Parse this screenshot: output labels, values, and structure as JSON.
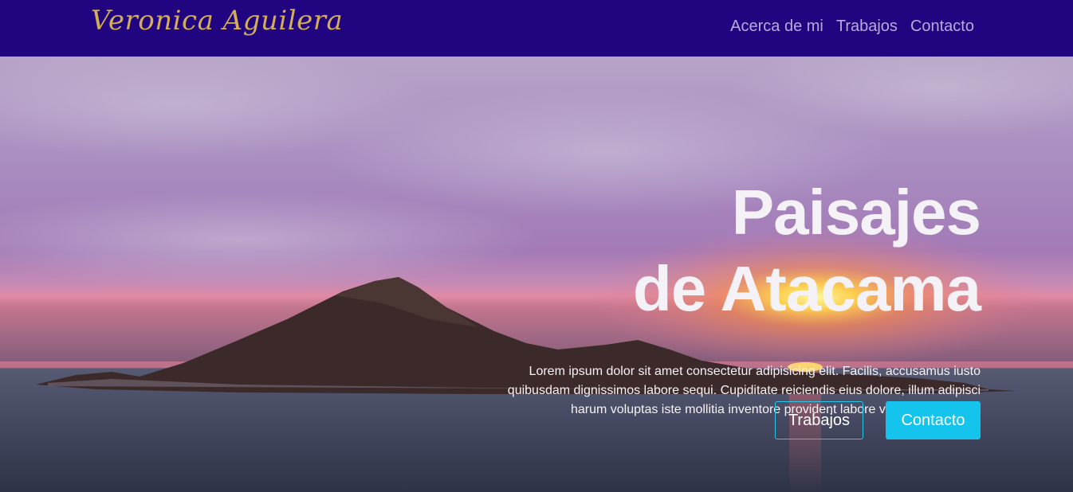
{
  "navbar": {
    "brand": "Veronica Aguilera",
    "links": [
      {
        "label": "Acerca de mi"
      },
      {
        "label": "Trabajos"
      },
      {
        "label": "Contacto"
      }
    ]
  },
  "hero": {
    "title_line1": "Paisajes",
    "title_line2": "de Atacama",
    "description": "Lorem ipsum dolor sit amet consectetur adipisicing elit. Facilis, accusamus iusto quibusdam dignissimos labore sequi. Cupiditate reiciendis eius dolore, illum adipisci harum voluptas iste mollitia inventore provident labore voluptatum nemo.",
    "buttons": {
      "primary": "Trabajos",
      "secondary": "Contacto"
    }
  },
  "colors": {
    "navbar_bg": "#21047f",
    "brand": "#d3ad57",
    "nav_link": "#b9a9df",
    "accent": "#14c4ec"
  }
}
